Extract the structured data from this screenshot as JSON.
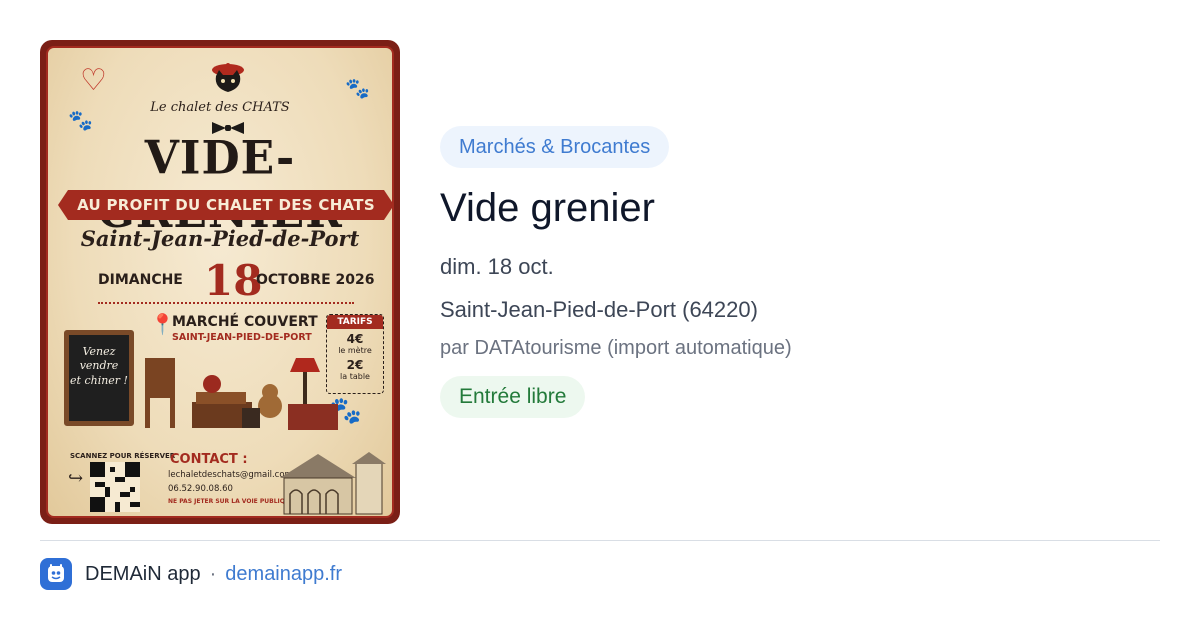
{
  "poster": {
    "brand": "Le chalet des CHATS",
    "title": "VIDE-GRENIER",
    "banner": "AU PROFIT DU CHALET DES CHATS",
    "town": "Saint-Jean-Pied-de-Port",
    "day": "DIMANCHE",
    "date_number": "18",
    "month_year": "OCTOBRE 2026",
    "venue": "MARCHÉ COUVERT",
    "venue_town": "SAINT-JEAN-PIED-DE-PORT",
    "tarifs_heading": "TARIFS",
    "tarif_1_value": "4€",
    "tarif_1_unit": "le mètre",
    "tarif_2_value": "2€",
    "tarif_2_unit": "la table",
    "board_text_1": "Venez",
    "board_text_2": "vendre",
    "board_text_3": "et chiner !",
    "scan_label": "SCANNEZ POUR RÉSERVER",
    "contact_heading": "CONTACT :",
    "contact_email": "lechaletdeschats@gmail.com",
    "contact_phone": "06.52.90.08.60",
    "notice": "NE PAS JETER SUR LA VOIE PUBLIQUE",
    "accent_color": "#a32b1f"
  },
  "event": {
    "category": "Marchés & Brocantes",
    "title": "Vide grenier",
    "date": "dim. 18 oct.",
    "place": "Saint-Jean-Pied-de-Port (64220)",
    "source": "par DATAtourisme (import automatique)",
    "price": "Entrée libre"
  },
  "footer": {
    "app_icon": "demain-app-icon",
    "app_name": "DEMAiN app",
    "separator": "·",
    "site": "demainapp.fr"
  },
  "colors": {
    "category_bg": "#edf4fd",
    "category_text": "#3f7bd0",
    "price_bg": "#edf8ef",
    "price_text": "#237a3a",
    "app_icon_bg": "#2f6fd6"
  }
}
